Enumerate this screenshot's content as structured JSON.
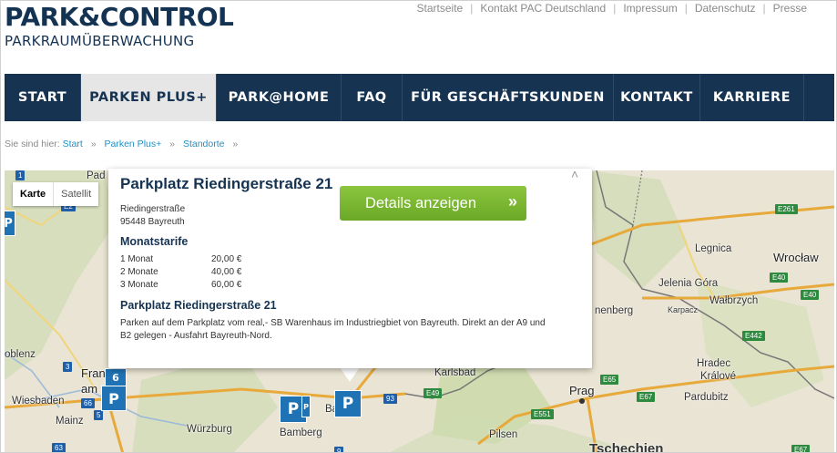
{
  "header": {
    "logo_left": "PARK",
    "logo_amp": "&",
    "logo_right": "CONTROL",
    "tagline": "PARKRAUMÜBERWACHUNG"
  },
  "topnav": [
    "Startseite",
    "Kontakt PAC Deutschland",
    "Impressum",
    "Datenschutz",
    "Presse"
  ],
  "mainnav": [
    "START",
    "PARKEN PLUS+",
    "PARK@HOME",
    "FAQ",
    "FÜR GESCHÄFTSKUNDEN",
    "KONTAKT",
    "KARRIERE"
  ],
  "mainnav_active": "PARKEN PLUS+",
  "breadcrumb": {
    "prefix": "Sie sind hier:",
    "items": [
      "Start",
      "Parken Plus+",
      "Standorte"
    ],
    "sep": "»"
  },
  "map": {
    "type_map": "Karte",
    "type_satellite": "Satellit",
    "labels": {
      "pad": "Pad",
      "oblenz": "oblenz",
      "frankfurt1": "Frank",
      "frankfurt2": "am",
      "wiesbaden": "Wiesbaden",
      "mainz": "Mainz",
      "wurzburg": "Würzburg",
      "bamberg": "Bamberg",
      "bayreuth": "Ba   th",
      "karlsbad": "Karlsbad",
      "pilsen": "Pilsen",
      "prag": "Prag",
      "tschechien": "Tschechien",
      "hradec1": "Hradec",
      "hradec2": "Králové",
      "pardubitz": "Pardubitz",
      "legnica": "Legnica",
      "wroclaw": "Wrocław",
      "jelenia": "Jelenia Góra",
      "walbrzych": "Wałbrzych",
      "karpacz": "Karpacz",
      "henberg": "nenberg",
      "lablk": "1"
    },
    "roads": {
      "e261": "E261",
      "e40a": "E40",
      "e40b": "E40",
      "e49": "E49",
      "e65": "E65",
      "e67": "E67",
      "e442": "E442",
      "e551": "E551",
      "e67b": "E67",
      "r93": "93",
      "r66": "66",
      "r5": "5",
      "r63": "63",
      "r9": "9",
      "r3": "3",
      "r1": "1",
      "e20": "E2"
    },
    "pins": {
      "pin_left": "P",
      "pin_frankfurt": "P",
      "pin_frankfurt_num": "6",
      "pin_bamberg": "P",
      "pin_bayreuth": "P",
      "pin_small": "P"
    }
  },
  "popup": {
    "title": "Parkplatz Riedingerstraße 21",
    "street": "Riedingerstraße",
    "city": "95448 Bayreuth",
    "tarif_heading": "Monatstarife",
    "tarife": [
      {
        "k": "1 Monat",
        "v": "20,00 €"
      },
      {
        "k": "2 Monate",
        "v": "40,00 €"
      },
      {
        "k": "3 Monate",
        "v": "60,00 €"
      }
    ],
    "sub_title": "Parkplatz Riedingerstraße 21",
    "description": "Parken auf dem Parkplatz vom real,- SB Warenhaus im Industriegbiet von Bayreuth. Direkt an der A9 und B2 gelegen - Ausfahrt Bayreuth-Nord.",
    "details_button": "Details anzeigen",
    "details_arrow": "»",
    "close": "˄"
  },
  "colors": {
    "navy": "#163352",
    "link": "#1f8fc4",
    "button_green": "#7ab732",
    "pin_blue": "#1f73b5"
  }
}
